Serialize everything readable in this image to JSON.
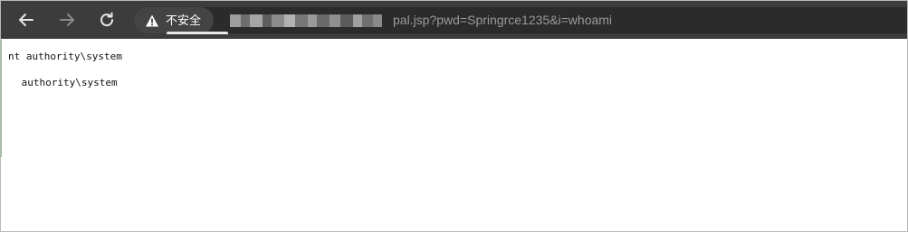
{
  "toolbar": {
    "back_icon": "arrow-left-icon",
    "forward_icon": "arrow-right-icon",
    "reload_icon": "reload-icon"
  },
  "omnibox": {
    "security_icon": "warning-triangle-icon",
    "security_label": "不安全",
    "url_visible_part": "pal.jsp?pwd=Springrce1235&i=whoami",
    "url_redacted": true
  },
  "page": {
    "output_lines": [
      "nt authority\\system",
      " authority\\system"
    ]
  },
  "colors": {
    "toolbar_bg": "#3c3c3c",
    "omnibox_bg": "#2b2b2b",
    "security_chip_bg": "#444444",
    "url_text": "#9a9a9a"
  }
}
